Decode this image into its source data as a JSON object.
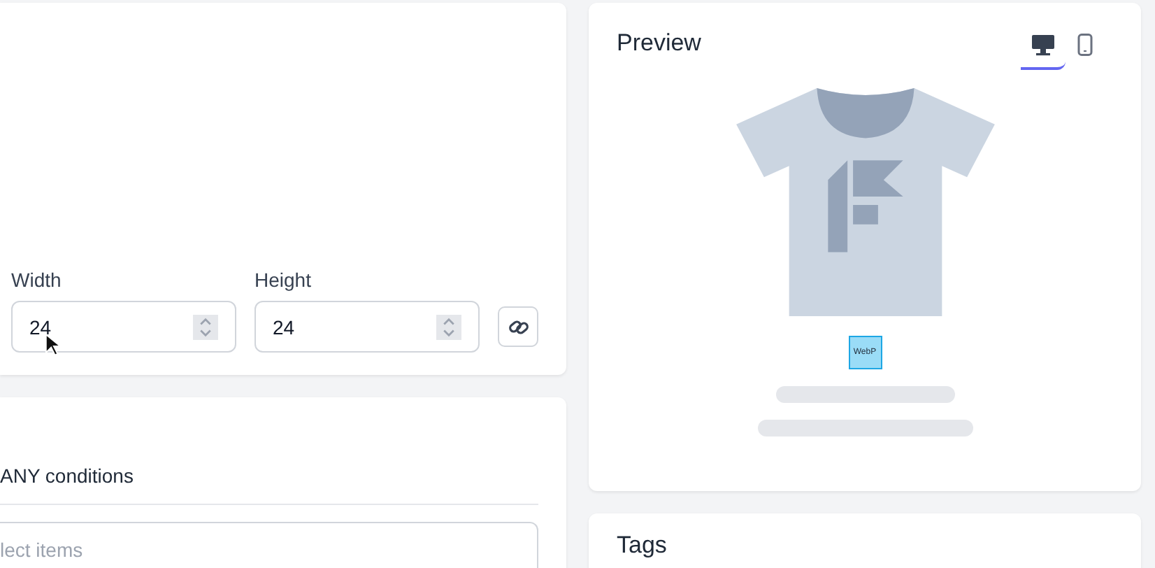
{
  "dimensions": {
    "width": {
      "label": "Width",
      "value": "24"
    },
    "height": {
      "label": "Height",
      "value": "24"
    },
    "linked": true
  },
  "conditions": {
    "text": "ANY conditions",
    "placeholder": "lect items"
  },
  "preview": {
    "title": "Preview",
    "tabs": [
      {
        "kind": "desktop",
        "selected": true
      },
      {
        "kind": "mobile",
        "selected": false
      }
    ],
    "format_badge": "WebP"
  },
  "tags": {
    "title": "Tags"
  }
}
